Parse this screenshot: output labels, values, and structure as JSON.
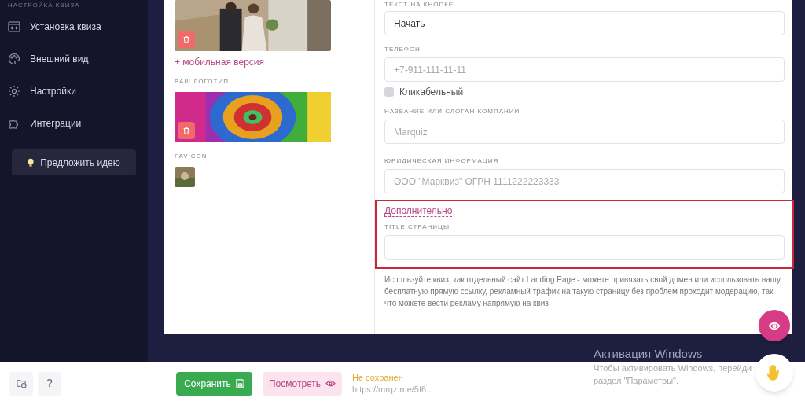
{
  "sidebar": {
    "header": "НАСТРОЙКА КВИЗА",
    "items": [
      {
        "label": "Установка квиза",
        "kind": "code"
      },
      {
        "label": "Внешний вид",
        "kind": "palette"
      },
      {
        "label": "Настройки",
        "kind": "gear"
      },
      {
        "label": "Интеграции",
        "kind": "puzzle"
      }
    ],
    "idea_button": "Предложить идею"
  },
  "media": {
    "mobile_link": "+ мобильная версия",
    "logo_label": "ВАШ ЛОГОТИП",
    "favicon_label": "FAVICON"
  },
  "fields": [
    {
      "label": "ТЕКСТ НА КНОПКЕ",
      "value": "Начать"
    },
    {
      "label": "ТЕЛЕФОН",
      "placeholder": "+7-911-111-11-11"
    },
    {
      "label": "НАЗВАНИЕ ИЛИ СЛОГАН КОМПАНИИ",
      "placeholder": "Marquiz"
    },
    {
      "label": "ЮРИДИЧЕСКАЯ ИНФОРМАЦИЯ",
      "placeholder": "ООО \"Марквиз\" ОГРН 1111222223333"
    }
  ],
  "clickable": {
    "label": "Кликабельный",
    "checked": false
  },
  "advanced": {
    "link": "Дополнительно",
    "title_label": "TITLE СТРАНИЦЫ"
  },
  "help_text": "Используйте квиз, как отдельный сайт Landing Page - можете привязать свой домен или использовать нашу бесплатную прямую ссылку, рекламный трафик на такую страницу без проблем проходит модерацию, так что можете вести рекламу напрямую на квиз.",
  "bottom_bar": {
    "save": "Сохранить",
    "preview": "Посмотреть",
    "status": "Не сохранен",
    "url": "https://mrqz.me/5f6...",
    "help": "?"
  },
  "windows_notice": {
    "title": "Активация Windows",
    "lines": [
      "Чтобы активировать Windows, перейди",
      "раздел \"Параметры\"."
    ]
  }
}
